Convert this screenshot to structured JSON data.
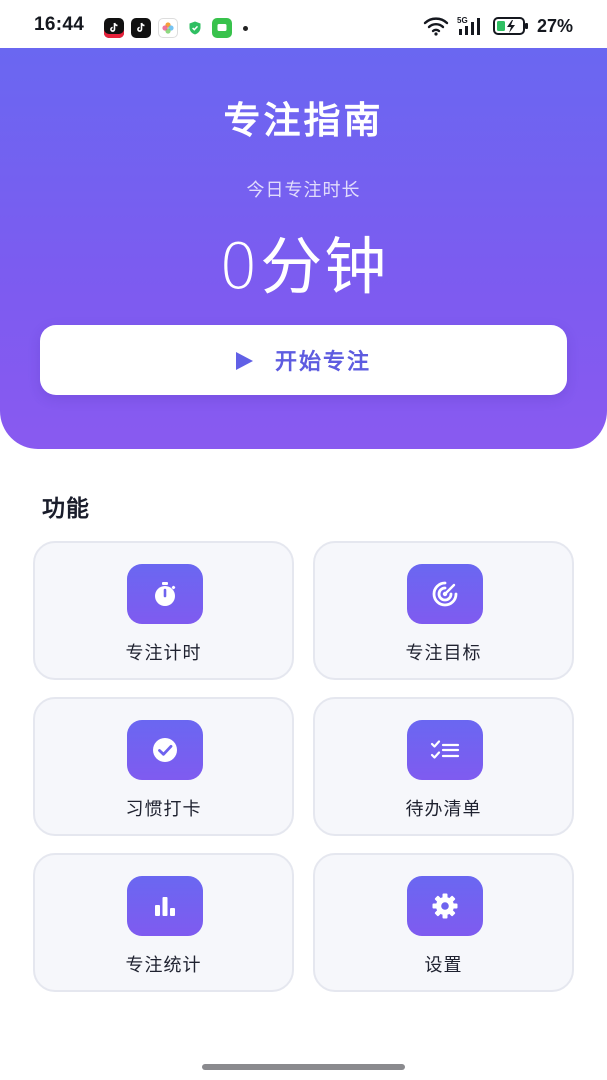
{
  "status_bar": {
    "time": "16:44",
    "network": "5G",
    "battery": "27%",
    "notification_icons": [
      "tiktok-lite-icon",
      "tiktok-icon",
      "photos-icon",
      "security-shield-icon",
      "messages-icon"
    ]
  },
  "header": {
    "title": "专注指南",
    "today_label": "今日专注时长",
    "today_value": "0分钟",
    "start_label": "开始专注"
  },
  "features": {
    "title": "功能",
    "items": [
      {
        "label": "专注计时",
        "icon": "stopwatch-icon"
      },
      {
        "label": "专注目标",
        "icon": "target-icon"
      },
      {
        "label": "习惯打卡",
        "icon": "check-circle-icon"
      },
      {
        "label": "待办清单",
        "icon": "checklist-icon"
      },
      {
        "label": "专注统计",
        "icon": "bar-chart-icon"
      },
      {
        "label": "设置",
        "icon": "gear-icon"
      }
    ]
  },
  "colors": {
    "accent": "#6a67f1",
    "accent_end": "#895af0",
    "card_bg": "#f6f7fb",
    "card_border": "#e5e7ef"
  }
}
